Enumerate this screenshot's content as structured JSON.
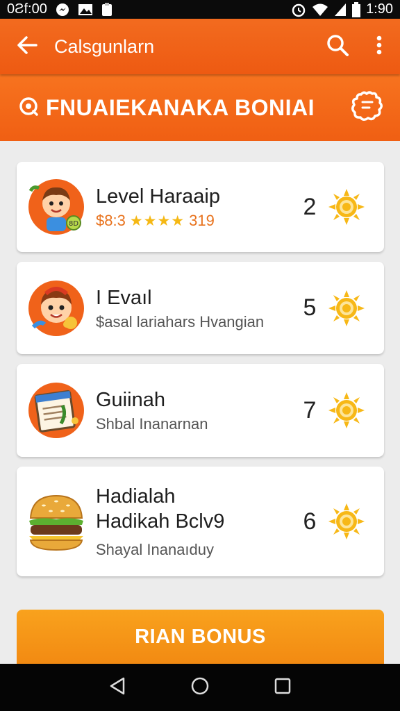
{
  "status_bar": {
    "time_left": "0Ƨf:00",
    "time_right": "1:90",
    "icons": [
      "messenger-icon",
      "image-icon",
      "clipboard-icon",
      "alarm-icon",
      "wifi-icon",
      "signal-icon",
      "battery-icon"
    ]
  },
  "app_bar": {
    "title": "Calsgunlarn",
    "back_icon": "arrow-left-icon",
    "actions": [
      "search-icon",
      "more-vert-icon"
    ]
  },
  "banner": {
    "title": "FNUAIEKANAKA BONIAI",
    "left_icon": "coin-icon",
    "right_icon": "gear-badge-icon"
  },
  "items": [
    {
      "title": "Level Haraaip",
      "subtitle_prefix": "$8:3",
      "stars": "★★★★",
      "subtitle_suffix": "319",
      "count": "2",
      "avatar": "kid-avatar-icon"
    },
    {
      "title": "I Evaıl",
      "subtitle": "$asal lariahars Hvangian",
      "count": "5",
      "avatar": "girl-avatar-icon"
    },
    {
      "title": "Guiinah",
      "subtitle": "Shbal Inanarnan",
      "count": "7",
      "avatar": "book-avatar-icon"
    },
    {
      "title": "Hadialah",
      "title2": "Hadikah Bclv9",
      "subtitle": "Shayal Inanaıduy",
      "count": "6",
      "avatar": "burger-icon"
    }
  ],
  "cta": {
    "label": "RIAN BONUS"
  },
  "nav": [
    "back-triangle-icon",
    "home-circle-icon",
    "recents-square-icon"
  ],
  "colors": {
    "primary": "#f06414",
    "accent": "#f59a1a",
    "sun": "#f7b817"
  }
}
